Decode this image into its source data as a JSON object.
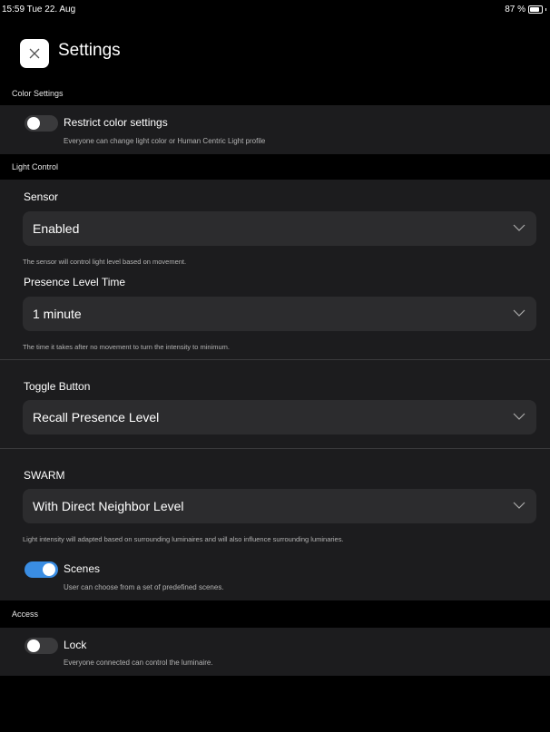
{
  "status_bar": {
    "time": "15:59  Tue 22. Aug",
    "battery": "87 %"
  },
  "header": {
    "title": "Settings"
  },
  "sections": {
    "color": {
      "header": "Color Settings"
    },
    "light": {
      "header": "Light Control"
    },
    "access": {
      "header": "Access"
    }
  },
  "color_settings": {
    "restrict": {
      "title": "Restrict color settings",
      "desc": "Everyone can change light color or Human Centric Light profile",
      "on": false
    }
  },
  "light_control": {
    "sensor": {
      "label": "Sensor",
      "value": "Enabled",
      "helper": "The sensor will control light level based on movement."
    },
    "presence": {
      "label": "Presence Level Time",
      "value": "1 minute",
      "helper": "The time it takes after no movement to turn the intensity to minimum."
    },
    "toggle_button": {
      "label": "Toggle Button",
      "value": "Recall Presence Level"
    },
    "swarm": {
      "label": "SWARM",
      "value": "With Direct Neighbor Level",
      "helper": "Light intensity will adapted based on surrounding luminaires and will also influence surrounding luminaries."
    },
    "scenes": {
      "title": "Scenes",
      "desc": "User can choose from a set of predefined scenes.",
      "on": true
    }
  },
  "access": {
    "lock": {
      "title": "Lock",
      "desc": "Everyone connected can control the luminaire.",
      "on": false
    }
  },
  "colors": {
    "background": "#000000",
    "panel": "#1c1c1e",
    "field": "#2c2c2e",
    "accent": "#3a8de3"
  },
  "icons": {
    "close": "close-icon",
    "chevron": "chevron-down-icon"
  }
}
